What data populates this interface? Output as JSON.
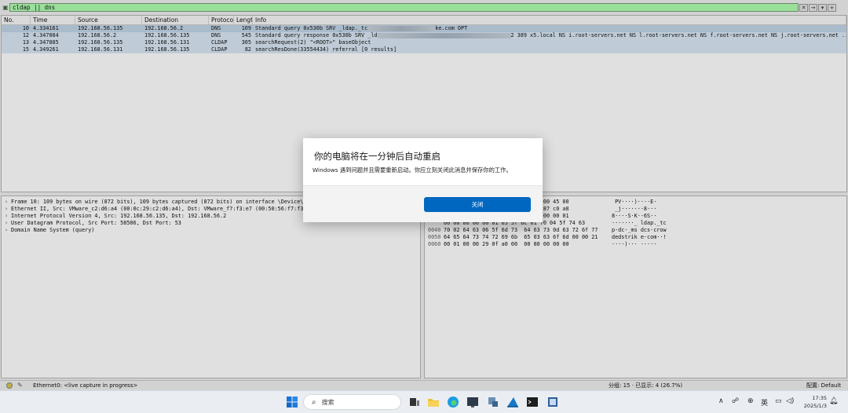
{
  "filter": {
    "value": "cldap || dns"
  },
  "packet_list": {
    "columns": [
      "No.",
      "Time",
      "Source",
      "Destination",
      "Protocol",
      "Lengtl",
      "Info"
    ],
    "rows": [
      {
        "no": "10",
        "time": "4.334161",
        "src": "192.168.56.135",
        "dst": "192.168.56.2",
        "proto": "DNS",
        "len": "109",
        "info_a": "Standard query 0x530b SRV _ldap._tc",
        "info_b": "ke.com OPT"
      },
      {
        "no": "12",
        "time": "4.347084",
        "src": "192.168.56.2",
        "dst": "192.168.56.135",
        "proto": "DNS",
        "len": "545",
        "info_a": "Standard query response 0x530b SRV _ld",
        "info_b": "2 389 x5.local NS i.root-servers.net NS l.root-servers.net NS f.root-servers.net NS j.root-servers.net ..."
      },
      {
        "no": "13",
        "time": "4.347885",
        "src": "192.168.56.135",
        "dst": "192.168.56.131",
        "proto": "CLDAP",
        "len": "305",
        "info_a": "searchRequest(2) \"<ROOT>\" baseObject",
        "info_b": ""
      },
      {
        "no": "15",
        "time": "4.349261",
        "src": "192.168.56.131",
        "dst": "192.168.56.135",
        "proto": "CLDAP",
        "len": "82",
        "info_a": "searchResDone(33554434) referral  [0 results]",
        "info_b": ""
      }
    ]
  },
  "details": [
    "Frame 10: 109 bytes on wire (872 bits), 109 bytes captured (872 bits) on interface \\Device\\",
    "Ethernet II, Src: VMware_c2:d6:a4 (00:0c:29:c2:d6:a4), Dst: VMware_f7:f3:e7 (00:50:56:f7:f3",
    "Internet Protocol Version 4, Src: 192.168.56.135, Dst: 192.168.56.2",
    "User Datagram Protocol, Src Port: 58506, Dst Port: 53",
    "Domain Name System (query)"
  ],
  "bytes": [
    {
      "off": "",
      "hex": "                      d6 a4 08 00 45 00",
      "asc": " PV····)····E·"
    },
    {
      "off": "",
      "hex": "                      c0 a8 38 87 c0 a8",
      "asc": " _j·······8···"
    },
    {
      "off": "",
      "hex": "                      53 0b 01 00 00 01",
      "asc": "8····S·K··6S··"
    },
    {
      "off": "",
      "hex": "00 00 00 00 00 01 05 5f 6c 61 70 04 5f 74 63",
      "asc": "·······_ ldap._tc"
    },
    {
      "off": "0040",
      "hex": "70 02 64 63 06 5f 6d 73  64 63 73 0d 63 72 6f 77",
      "asc": "p·dc·_ms dcs·crow"
    },
    {
      "off": "0050",
      "hex": "64 65 64 73 74 72 69 6b  65 03 63 6f 6d 00 00 21",
      "asc": "dedstrik e·com··!"
    },
    {
      "off": "0060",
      "hex": "00 01 00 00 29 0f a0 00  00 80 00 00 00",
      "asc": "····)··· ·····"
    }
  ],
  "status": {
    "capture": "Ethernet0: <live capture in progress>",
    "packets": "分组: 15 · 已显示: 4 (26.7%)",
    "profile": "配置: Default"
  },
  "dialog": {
    "title": "你的电脑将在一分钟后自动重启",
    "message": "Windows 遇到问题并且需要重新启动。你应立刻关闭此消息并保存你的工作。",
    "close_label": "关闭"
  },
  "taskbar": {
    "search_placeholder": "搜索",
    "ime": "英",
    "time": "17:35",
    "date": "2025/1/3"
  },
  "colors": {
    "filter_bg": "#afffaf",
    "accent": "#0067c0",
    "row_bg": "#dae8f5"
  }
}
